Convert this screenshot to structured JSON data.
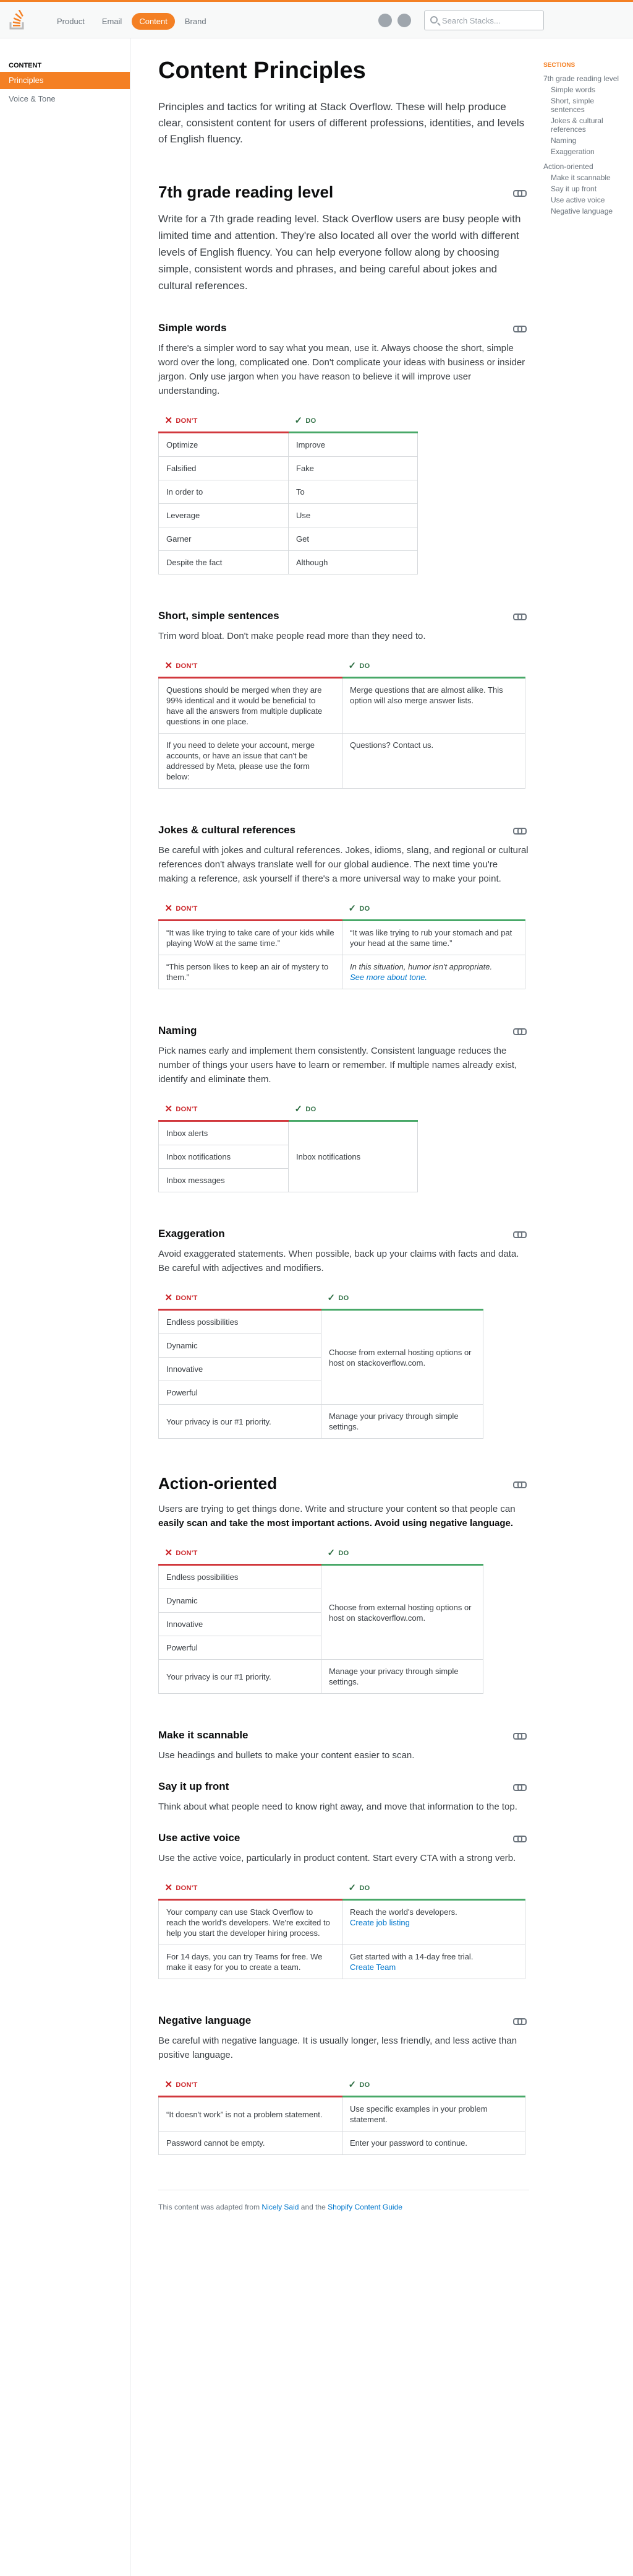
{
  "nav": {
    "links": [
      "Product",
      "Email",
      "Content",
      "Brand"
    ],
    "active": "Content",
    "search_placeholder": "Search Stacks..."
  },
  "leftnav": {
    "heading": "CONTENT",
    "items": [
      "Principles",
      "Voice & Tone"
    ]
  },
  "toc": {
    "heading": "SECTIONS",
    "items": [
      {
        "label": "7th grade reading level",
        "level": 1
      },
      {
        "label": "Simple words",
        "level": 2
      },
      {
        "label": "Short, simple sentences",
        "level": 2
      },
      {
        "label": "Jokes & cultural references",
        "level": 2
      },
      {
        "label": "Naming",
        "level": 2
      },
      {
        "label": "Exaggeration",
        "level": 2
      },
      {
        "label": "Action-oriented",
        "level": 1
      },
      {
        "label": "Make it scannable",
        "level": 2
      },
      {
        "label": "Say it up front",
        "level": 2
      },
      {
        "label": "Use active voice",
        "level": 2
      },
      {
        "label": "Negative language",
        "level": 2
      }
    ]
  },
  "page": {
    "title": "Content Principles",
    "lead": "Principles and tactics for writing at Stack Overflow. These will help produce clear, consistent content for users of different professions, identities, and levels of English fluency."
  },
  "labels": {
    "dont": "DON'T",
    "do": "DO"
  },
  "sections": {
    "reading": {
      "title": "7th grade reading level",
      "body": "Write for a 7th grade reading level. Stack Overflow users are busy people with limited time and attention. They're also located all over the world with different levels of English fluency. You can help everyone follow along by choosing simple, consistent words and phrases, and being careful about jokes and cultural references."
    },
    "simple_words": {
      "title": "Simple words",
      "body": "If there's a simpler word to say what you mean, use it. Always choose the short, simple word over the long, complicated one. Don't complicate your ideas with business or insider jargon. Only use jargon when you have reason to believe it will improve user understanding.",
      "rows": [
        [
          "Optimize",
          "Improve"
        ],
        [
          "Falsified",
          "Fake"
        ],
        [
          "In order to",
          "To"
        ],
        [
          "Leverage",
          "Use"
        ],
        [
          "Garner",
          "Get"
        ],
        [
          "Despite the fact",
          "Although"
        ]
      ]
    },
    "short_sentences": {
      "title": "Short, simple sentences",
      "body": "Trim word bloat. Don't make people read more than they need to.",
      "rows": [
        [
          "Questions should be merged when they are 99% identical and it would be beneficial to have all the answers from multiple duplicate questions in one place.",
          "Merge questions that are almost alike. This option will also merge answer lists."
        ],
        [
          "If you need to delete your account, merge accounts, or have an issue that can't be addressed by Meta, please use the form below:",
          "Questions? Contact us."
        ]
      ]
    },
    "jokes": {
      "title": "Jokes & cultural references",
      "body": "Be careful with jokes and cultural references. Jokes, idioms, slang, and regional or cultural references don't always translate well for our global audience. The next time you're making a reference, ask yourself if there's a more universal way to make your point.",
      "rows": [
        [
          "“It was like trying to take care of your kids while playing WoW at the same time.”",
          "“It was like trying to rub your stomach and pat your head at the same time.”"
        ],
        [
          "“This person likes to keep an air of mystery to them.”",
          ""
        ]
      ],
      "note": "In this situation, humor isn't appropriate.",
      "note_link": "See more about tone."
    },
    "naming": {
      "title": "Naming",
      "body": "Pick names early and implement them consistently. Consistent language reduces the number of things your users have to learn or remember. If multiple names already exist, identify and eliminate them.",
      "dont": [
        "Inbox alerts",
        "Inbox notifications",
        "Inbox messages"
      ],
      "do": "Inbox notifications"
    },
    "exaggeration": {
      "title": "Exaggeration",
      "body": "Avoid exaggerated statements. When possible, back up your claims with facts and data. Be careful with adjectives and modifiers.",
      "dont": [
        "Endless possibilities",
        "Dynamic",
        "Innovative",
        "Powerful"
      ],
      "do": "Choose from external hosting options or host on stackoverflow.com.",
      "row2": [
        "Your privacy is our #1 priority.",
        "Manage your privacy through simple settings."
      ]
    },
    "action": {
      "title": "Action-oriented",
      "body_start": "Users are trying to get things done. Write and structure your content so that people can ",
      "body_bold": "easily scan and take the most important actions. Avoid using negative language.",
      "dont": [
        "Endless possibilities",
        "Dynamic",
        "Innovative",
        "Powerful"
      ],
      "do": "Choose from external hosting options or host on stackoverflow.com.",
      "row2": [
        "Your privacy is our #1 priority.",
        "Manage your privacy through simple settings."
      ]
    },
    "scannable": {
      "title": "Make it scannable",
      "body": "Use headings and bullets to make your content easier to scan."
    },
    "upfront": {
      "title": "Say it up front",
      "body": "Think about what people need to know right away, and move that information to the top."
    },
    "active_voice": {
      "title": "Use active voice",
      "body": "Use the active voice, particularly in product content. Start every CTA with a strong verb.",
      "rows": [
        {
          "dont": "Your company can use Stack Overflow to reach the world's developers. We're excited to help you start the developer hiring process.",
          "do_text": "Reach the world's developers.",
          "do_link": "Create job listing"
        },
        {
          "dont": "For 14 days, you can try Teams for free. We make it easy for you to create a team.",
          "do_text": "Get started with a 14-day free trial.",
          "do_link": "Create Team"
        }
      ]
    },
    "negative": {
      "title": "Negative language",
      "body": "Be careful with negative language. It is usually longer, less friendly, and less active than positive language.",
      "rows": [
        [
          "“It doesn't work” is not a problem statement.",
          "Use specific examples in your problem statement."
        ],
        [
          "Password cannot be empty.",
          "Enter your password to continue."
        ]
      ]
    }
  },
  "footer": {
    "prefix": "This content was adapted from ",
    "link1": "Nicely Said",
    "middle": " and the ",
    "link2": "Shopify Content Guide"
  }
}
